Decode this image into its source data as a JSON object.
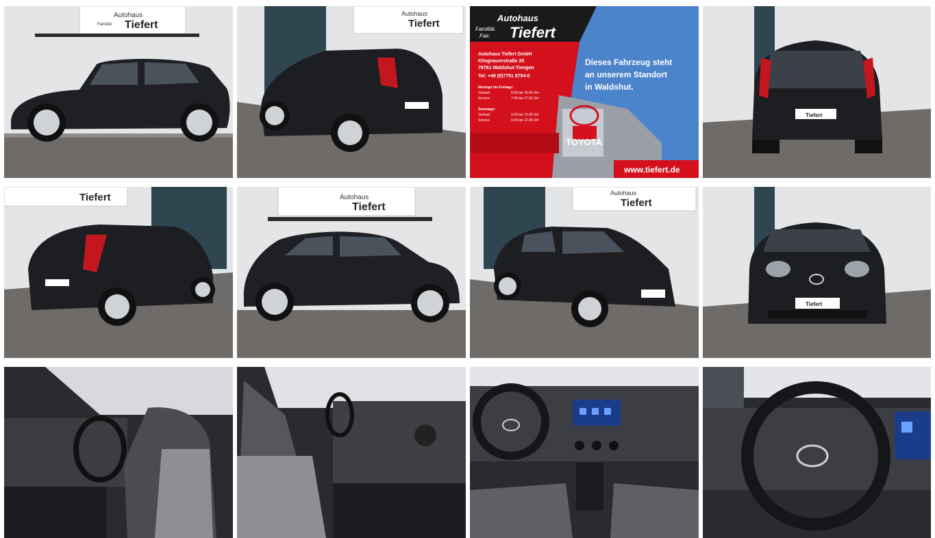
{
  "gallery": {
    "dealer_sign": {
      "line1": "Autohaus",
      "line2a": "Familiär.",
      "line2b": "Fair.",
      "name": "Tiefert"
    },
    "info_card": {
      "brand_line1": "Autohaus",
      "brand_line2a": "Familiär.",
      "brand_line2b": "Fair.",
      "brand_name": "Tiefert",
      "company": "Autohaus Tiefert GmbH",
      "street": "Klingnauerstraße 20",
      "city": "79761 Waldshut-Tiengen",
      "phone": "Tel: +49 (0)7751 8754-0",
      "weekdays_heading": "Montags bis Freitags:",
      "weekdays_sales_label": "Verkauf",
      "weekdays_sales_hours": "8.00 bis 18.00 Uhr",
      "weekdays_service_label": "Service",
      "weekdays_service_hours": "7.45 bis 17.30 Uhr",
      "saturday_heading": "Samstags:",
      "saturday_sales_label": "Verkauf",
      "saturday_sales_hours": "9.00 bis 13.00 Uhr",
      "saturday_service_label": "Service",
      "saturday_service_hours": "9.00 bis 12.00 Uhr",
      "headline_line1": "Dieses Fahrzeug steht",
      "headline_line2": "an unserem Standort",
      "headline_line3": "in Waldshut.",
      "toyota_label": "TOYOTA",
      "website": "www.tiefert.de"
    },
    "plate_text": "Tiefert",
    "colors": {
      "car_body": "#1e1f24",
      "wall": "#e6e7e9",
      "pavement": "#6d6a68",
      "red_panel": "#d4101d",
      "blue_sky": "#4c84cc"
    }
  }
}
